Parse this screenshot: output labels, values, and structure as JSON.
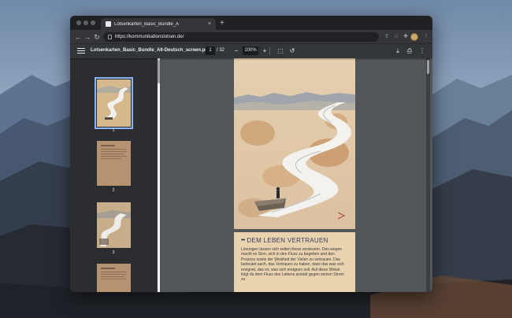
{
  "browser": {
    "tab": {
      "title": "Lotsenkarten_Basic_Bundle_A",
      "close_glyph": "×"
    },
    "new_tab_glyph": "+",
    "nav": {
      "back": "←",
      "forward": "→",
      "reload": "↻"
    },
    "url": "https://kommunikationslotsen.de/"
  },
  "pdf": {
    "title": "Lotsenkarten_Basic_Bundle_A6-Deutsch_screen.pdf",
    "current_page": "1",
    "page_separator": "/",
    "total_pages": "32",
    "zoom_out": "−",
    "zoom": "100%",
    "zoom_in": "+",
    "thumbnails": [
      {
        "label": "1",
        "kind": "illustration"
      },
      {
        "label": "2",
        "kind": "text"
      },
      {
        "label": "3",
        "kind": "illustration"
      },
      {
        "label": "4",
        "kind": "text"
      }
    ],
    "card_back": {
      "dots": "•••",
      "heading": "DEM LEBEN VERTRAUEN",
      "body": "Lösungen lassen sich selten linear ansteuern. Des-wegen macht es Sinn, sich in den Fluss zu begeben und den Prozess sowie der Weisheit der Vielen zu vertrauen. Das bedeutet auch, das Vertrauen zu haben, dass das was sich ereignet, das ist, was sich ereignen soll. Auf diese Weise folgt du dem Fluss des Lebens anstatt gegen seinen Strom zu"
    }
  },
  "colors": {
    "accent": "#8ab4f8",
    "card_paper": "#e9d2ae",
    "viewer_bg": "#525659",
    "toolbar_bg": "#323639"
  }
}
